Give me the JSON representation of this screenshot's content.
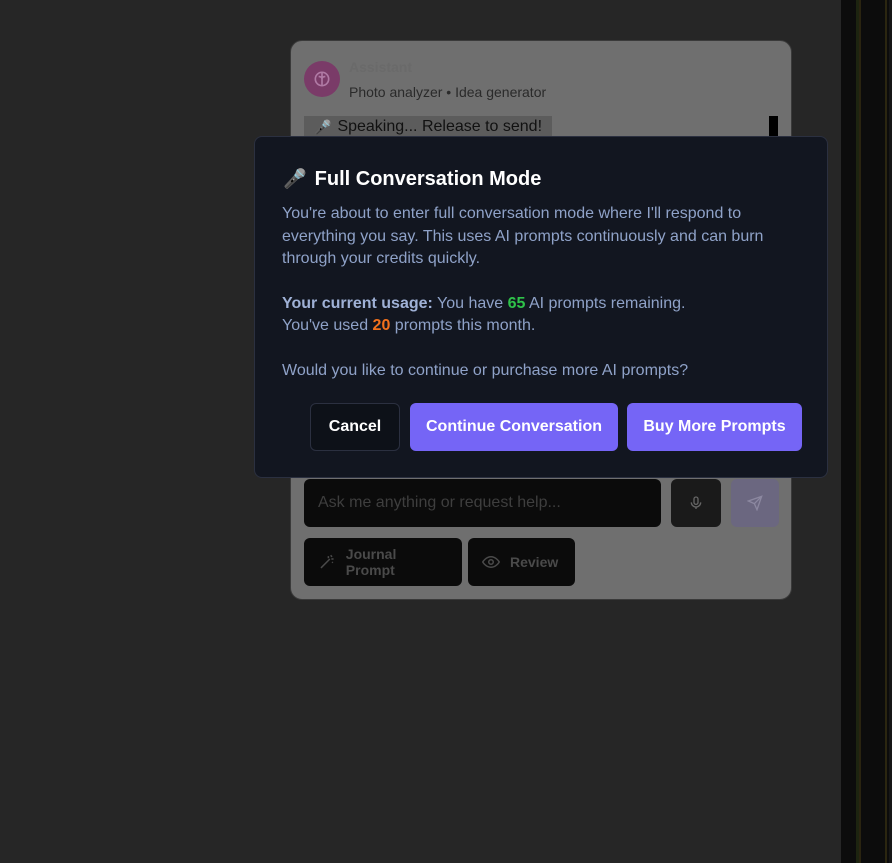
{
  "chat_panel": {
    "assistant_name": "Assistant",
    "assistant_subtitle": "Photo analyzer • Idea generator",
    "speaking_status": "Speaking... Release to send!",
    "input_placeholder": "Ask me anything or request help...",
    "actions": [
      {
        "label": "Journal Prompt",
        "icon": "magic-wand-icon"
      },
      {
        "label": "Review",
        "icon": "eye-icon"
      }
    ]
  },
  "modal": {
    "icon": "microphone-icon",
    "title": "Full Conversation Mode",
    "intro": "You're about to enter full conversation mode where I'll respond to everything you say. This uses AI prompts continuously and can burn through your credits quickly.",
    "usage_label": "Your current usage:",
    "usage_prefix": "You have",
    "prompts_remaining": "65",
    "usage_suffix": "AI prompts remaining.",
    "used_prefix": "You've used",
    "prompts_used": "20",
    "used_suffix": "prompts this month.",
    "question": "Would you like to continue or purchase more AI prompts?",
    "buttons": {
      "cancel": "Cancel",
      "continue": "Continue Conversation",
      "buy": "Buy More Prompts"
    }
  },
  "colors": {
    "accent": "#7565f6",
    "remaining_number": "#2fc24a",
    "used_number": "#f2711c",
    "modal_background": "#121620"
  }
}
